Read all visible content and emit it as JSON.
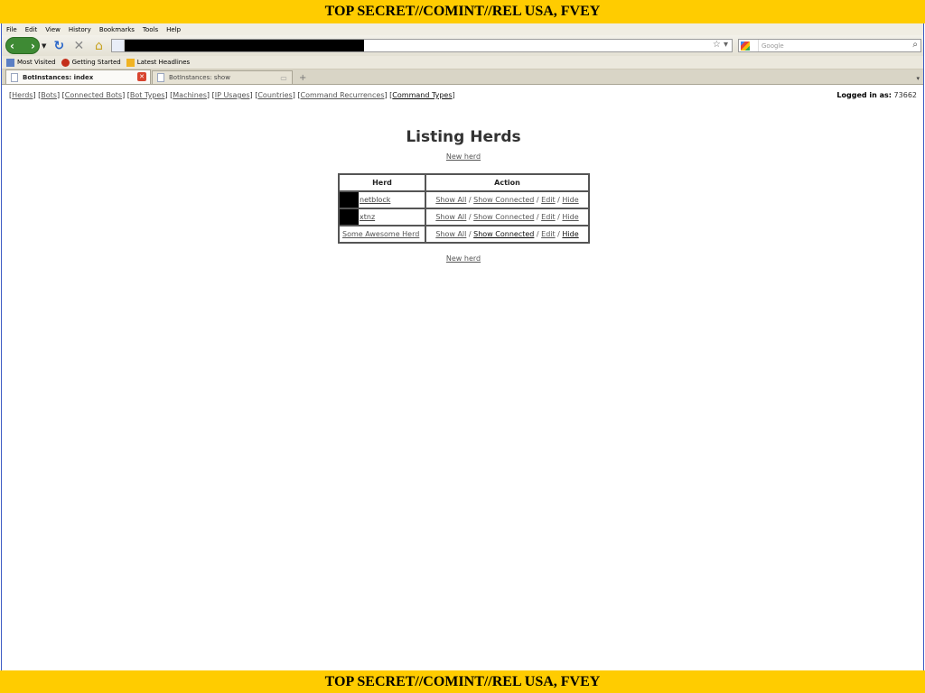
{
  "classification": {
    "top": "TOP SECRET//COMINT//REL USA, FVEY",
    "bottom": "TOP SECRET//COMINT//REL USA, FVEY"
  },
  "menu": [
    "File",
    "Edit",
    "View",
    "History",
    "Bookmarks",
    "Tools",
    "Help"
  ],
  "search": {
    "placeholder": "Google"
  },
  "bookmarks": [
    "Most Visited",
    "Getting Started",
    "Latest Headlines"
  ],
  "tabs": [
    {
      "label": "BotInstances: index"
    },
    {
      "label": "BotInstances: show"
    }
  ],
  "nav_links": [
    "Herds",
    "Bots",
    "Connected Bots",
    "Bot Types",
    "Machines",
    "IP Usages",
    "Countries",
    "Command Recurrences",
    "Command Types"
  ],
  "login": {
    "label": "Logged in as:",
    "user": "73662"
  },
  "page": {
    "title": "Listing Herds",
    "new_herd_top": "New herd",
    "new_herd_bottom": "New herd",
    "columns": [
      "Herd",
      "Action"
    ],
    "rows": [
      {
        "herd": "netblock",
        "actions": [
          "Show All",
          "Show Connected",
          "Edit",
          "Hide"
        ]
      },
      {
        "herd": "xtnz",
        "actions": [
          "Show All",
          "Show Connected",
          "Edit",
          "Hide"
        ]
      },
      {
        "herd": "Some Awesome Herd",
        "actions": [
          "Show All",
          "Show Connected",
          "Edit",
          "Hide"
        ]
      }
    ]
  },
  "colors": {
    "classification_bar": "#ffcc00",
    "window_border": "#3d5cc4"
  }
}
